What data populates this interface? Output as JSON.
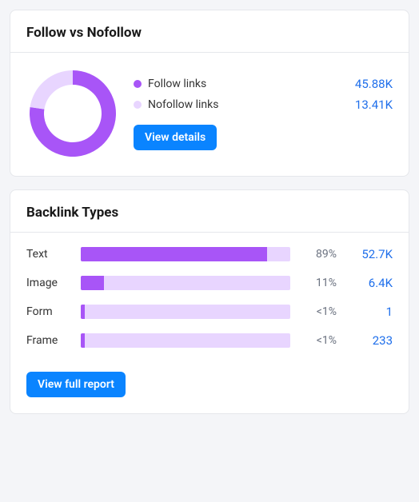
{
  "follow_card": {
    "title": "Follow vs Nofollow",
    "button_label": "View details",
    "legend": [
      {
        "label": "Follow links",
        "value": "45.88K",
        "color": "#a855f7"
      },
      {
        "label": "Nofollow links",
        "value": "13.41K",
        "color": "#e8d5ff"
      }
    ]
  },
  "backlink_card": {
    "title": "Backlink Types",
    "button_label": "View full report",
    "rows": [
      {
        "label": "Text",
        "percent_label": "89%",
        "fill_pct": 89,
        "count": "52.7K"
      },
      {
        "label": "Image",
        "percent_label": "11%",
        "fill_pct": 11,
        "count": "6.4K"
      },
      {
        "label": "Form",
        "percent_label": "<1%",
        "fill_pct": 0.5,
        "count": "1"
      },
      {
        "label": "Frame",
        "percent_label": "<1%",
        "fill_pct": 0.5,
        "count": "233"
      }
    ]
  },
  "chart_data": [
    {
      "type": "pie",
      "title": "Follow vs Nofollow",
      "series": [
        {
          "name": "Follow links",
          "value": 45880,
          "display": "45.88K",
          "color": "#a855f7"
        },
        {
          "name": "Nofollow links",
          "value": 13410,
          "display": "13.41K",
          "color": "#e8d5ff"
        }
      ]
    },
    {
      "type": "bar",
      "title": "Backlink Types",
      "orientation": "horizontal",
      "categories": [
        "Text",
        "Image",
        "Form",
        "Frame"
      ],
      "series": [
        {
          "name": "percent",
          "values": [
            89,
            11,
            0.5,
            0.5
          ],
          "display": [
            "89%",
            "11%",
            "<1%",
            "<1%"
          ]
        },
        {
          "name": "count",
          "values": [
            52700,
            6400,
            1,
            233
          ],
          "display": [
            "52.7K",
            "6.4K",
            "1",
            "233"
          ]
        }
      ],
      "xlabel": "",
      "ylabel": "",
      "xlim": [
        0,
        100
      ]
    }
  ]
}
